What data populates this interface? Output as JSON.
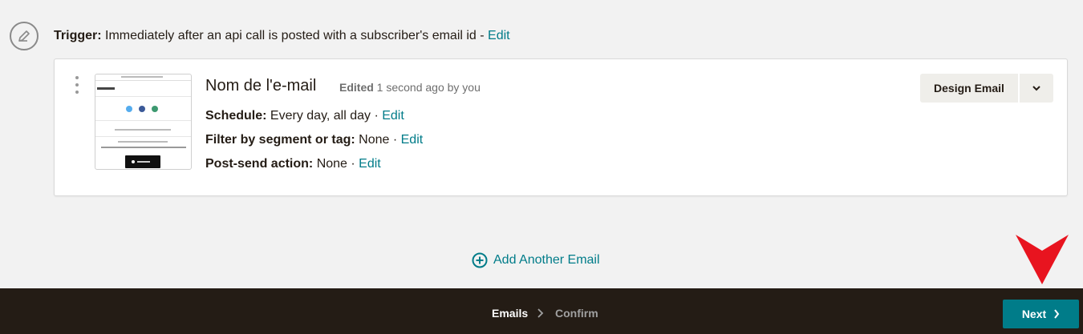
{
  "trigger": {
    "label": "Trigger:",
    "text": "Immediately after an api call is posted with a subscriber's email id - ",
    "edit": "Edit"
  },
  "email": {
    "name": "Nom de l'e-mail",
    "edited_label": "Edited",
    "edited_text": "1 second ago by you",
    "schedule_label": "Schedule:",
    "schedule_value": "Every day, all day · ",
    "schedule_edit": "Edit",
    "filter_label": "Filter by segment or tag:",
    "filter_value": "None · ",
    "filter_edit": "Edit",
    "post_label": "Post-send action:",
    "post_value": "None · ",
    "post_edit": "Edit",
    "design_button": "Design Email"
  },
  "add_email": {
    "label": "Add Another Email"
  },
  "footer": {
    "steps": [
      "Emails",
      "Confirm"
    ],
    "next_label": "Next"
  },
  "colors": {
    "link": "#007c89",
    "footer_bg": "#241c15",
    "next_bg": "#007c89",
    "arrow": "#e8141f"
  },
  "icons": [
    "pencil-icon",
    "kebab-icon",
    "chevron-down-icon",
    "plus-circle-icon",
    "chevron-right-icon",
    "arrow-down-indicator"
  ]
}
